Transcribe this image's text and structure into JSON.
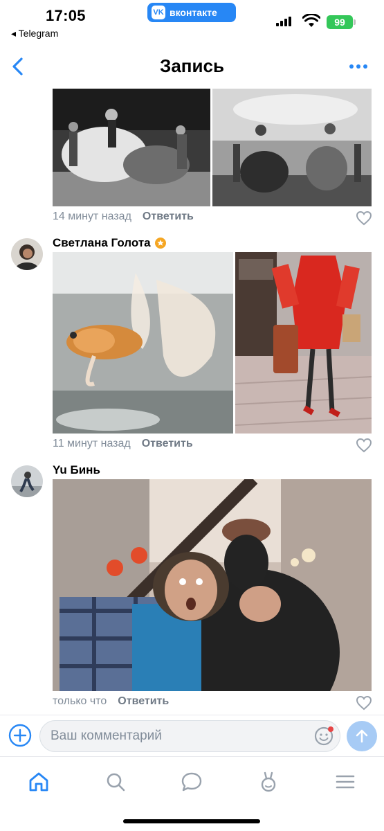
{
  "status_bar": {
    "time": "17:05",
    "back_app": "◂ Telegram",
    "app_badge": "вконтакте",
    "battery": "99"
  },
  "header": {
    "title": "Запись",
    "back_icon": "chevron-left-icon",
    "more_icon": "more-dots-icon"
  },
  "comments": [
    {
      "author": "",
      "time": "14 минут назад",
      "reply": "Ответить"
    },
    {
      "author": "Светлана Голота",
      "time": "11 минут назад",
      "reply": "Ответить"
    },
    {
      "author": "Yu Бинь",
      "time": "только что",
      "reply": "Ответить"
    }
  ],
  "composer": {
    "placeholder": "Ваш комментарий"
  },
  "tabs": [
    {
      "icon": "home-icon"
    },
    {
      "icon": "search-icon"
    },
    {
      "icon": "messages-icon"
    },
    {
      "icon": "clips-icon"
    },
    {
      "icon": "menu-icon"
    }
  ],
  "colors": {
    "accent": "#2787f5",
    "meta": "#818c99",
    "battery": "#34c759",
    "send_disabled": "#a7cbf5"
  }
}
